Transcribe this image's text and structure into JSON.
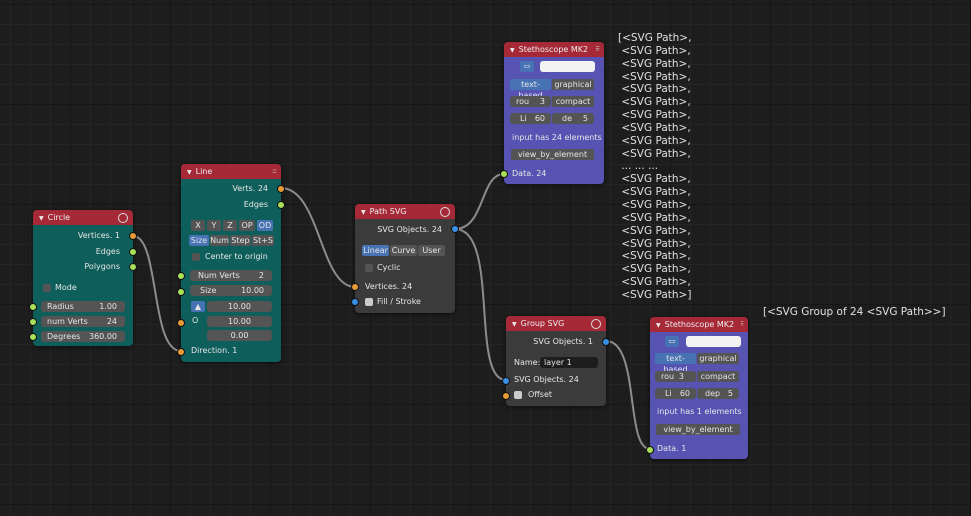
{
  "circle": {
    "title": "Circle",
    "outputs": [
      "Vertices. 1",
      "Edges",
      "Polygons"
    ],
    "mode_label": "Mode",
    "fields": [
      {
        "label": "Radius",
        "value": "1.00"
      },
      {
        "label": "num Verts",
        "value": "24"
      },
      {
        "label": "Degrees",
        "value": "360.00"
      }
    ]
  },
  "line": {
    "title": "Line",
    "outputs": [
      "Verts. 24",
      "Edges"
    ],
    "axis_buttons": [
      "X",
      "Y",
      "Z",
      "OP",
      "OD"
    ],
    "mode_buttons": [
      "Size",
      "Num",
      "Step",
      "St+S"
    ],
    "center_label": "Center to origin",
    "fields": [
      {
        "label": "Num Verts",
        "value": "2"
      },
      {
        "label": "Size",
        "value": "10.00"
      }
    ],
    "vector_values": [
      "10.00",
      "10.00",
      "0.00"
    ],
    "o_label": "O",
    "direction_label": "Direction. 1"
  },
  "path_svg": {
    "title": "Path SVG",
    "output": "SVG Objects. 24",
    "modes": [
      "Linear",
      "Curve",
      "User"
    ],
    "cyclic_label": "Cyclic",
    "inputs": [
      "Vertices. 24",
      "Fill / Stroke"
    ]
  },
  "group_svg": {
    "title": "Group SVG",
    "output": "SVG Objects. 1",
    "name_label": "Name:",
    "name_value": "layer 1",
    "inputs": [
      "SVG Objects. 24",
      "Offset"
    ]
  },
  "steth1": {
    "title": "Stethoscope MK2",
    "mode_buttons": [
      "text-based",
      "graphical"
    ],
    "rou_label": "rou",
    "rou_value": "3",
    "compact_label": "compact",
    "li_label": "Li",
    "li_value": "60",
    "de_label": "de",
    "de_value": "5",
    "info": "input has 24 elements",
    "view_button": "view_by_element",
    "input": "Data. 24"
  },
  "steth2": {
    "title": "Stethoscope MK2",
    "mode_buttons": [
      "text-based",
      "graphical"
    ],
    "rou_label": "rou",
    "rou_value": "3",
    "compact_label": "compact",
    "li_label": "Li",
    "li_value": "60",
    "de_label": "dep",
    "de_value": "5",
    "info": "input has 1 elements",
    "view_button": "view_by_element",
    "input": "Data. 1"
  },
  "output1_lines": [
    "[<SVG Path>,",
    " <SVG Path>,",
    " <SVG Path>,",
    " <SVG Path>,",
    " <SVG Path>,",
    " <SVG Path>,",
    " <SVG Path>,",
    " <SVG Path>,",
    " <SVG Path>,",
    " <SVG Path>,",
    " ... ... ...",
    " <SVG Path>,",
    " <SVG Path>,",
    " <SVG Path>,",
    " <SVG Path>,",
    " <SVG Path>,",
    " <SVG Path>,",
    " <SVG Path>,",
    " <SVG Path>,",
    " <SVG Path>,",
    " <SVG Path>]"
  ],
  "output2_text": "[<SVG Group of 24 <SVG Path>>]",
  "colors": {
    "header": "#a52937",
    "teal_body": "#0e5e5b",
    "gray_body": "#3b3b3b",
    "purple_body": "#5753b2",
    "socket_green": "#a8e05a",
    "socket_orange": "#e89a36",
    "socket_blue": "#3a8ee8"
  }
}
